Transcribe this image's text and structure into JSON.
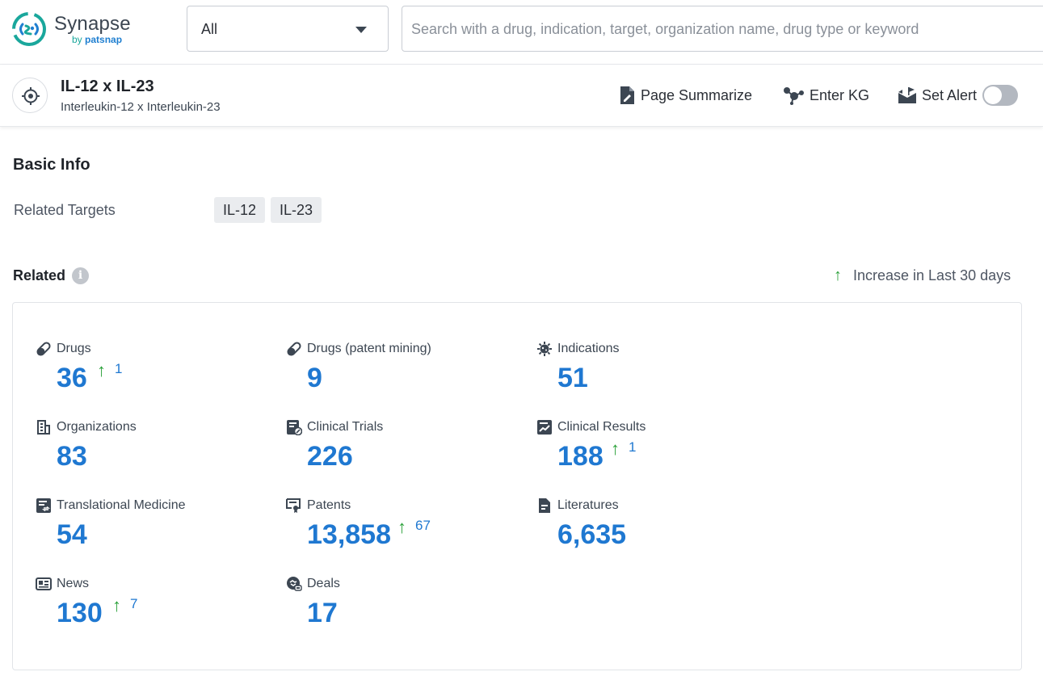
{
  "brand": {
    "name": "Synapse",
    "by_prefix": "by",
    "by_name": "patsnap",
    "colors": {
      "teal": "#1aa79c",
      "blue": "#1f7fd0"
    }
  },
  "search": {
    "scope_value": "All",
    "placeholder": "Search with a drug, indication, target, organization name, drug type or keyword",
    "value": ""
  },
  "entity": {
    "icon": "target-icon",
    "title": "IL-12 x IL-23",
    "subtitle": "Interleukin-12 x Interleukin-23",
    "actions": {
      "summarize": "Page Summarize",
      "kg": "Enter KG",
      "alert": "Set Alert",
      "alert_on": false
    }
  },
  "basic_info": {
    "heading": "Basic Info",
    "related_targets_label": "Related Targets",
    "related_targets": [
      "IL-12",
      "IL-23"
    ]
  },
  "related": {
    "heading": "Related",
    "info_glyph": "i",
    "legend_arrow": "↑",
    "legend_text": "Increase in Last 30 days",
    "colors": {
      "number": "#1f78d1",
      "increase": "#2ba13a"
    },
    "stats": [
      {
        "label": "Drugs",
        "icon": "pill-icon",
        "value": "36",
        "increase": "1"
      },
      {
        "label": "Drugs (patent mining)",
        "icon": "pill-icon",
        "value": "9",
        "increase": null
      },
      {
        "label": "Indications",
        "icon": "virus-icon",
        "value": "51",
        "increase": null
      },
      {
        "label": "Organizations",
        "icon": "building-icon",
        "value": "83",
        "increase": null
      },
      {
        "label": "Clinical Trials",
        "icon": "clinical-trial-icon",
        "value": "226",
        "increase": null
      },
      {
        "label": "Clinical Results",
        "icon": "chart-report-icon",
        "value": "188",
        "increase": "1"
      },
      {
        "label": "Translational Medicine",
        "icon": "document-transfer-icon",
        "value": "54",
        "increase": null
      },
      {
        "label": "Patents",
        "icon": "certificate-icon",
        "value": "13,858",
        "increase": "67"
      },
      {
        "label": "Literatures",
        "icon": "document-icon",
        "value": "6,635",
        "increase": null
      },
      {
        "label": "News",
        "icon": "newspaper-icon",
        "value": "130",
        "increase": "7"
      },
      {
        "label": "Deals",
        "icon": "handshake-icon",
        "value": "17",
        "increase": null
      }
    ]
  }
}
